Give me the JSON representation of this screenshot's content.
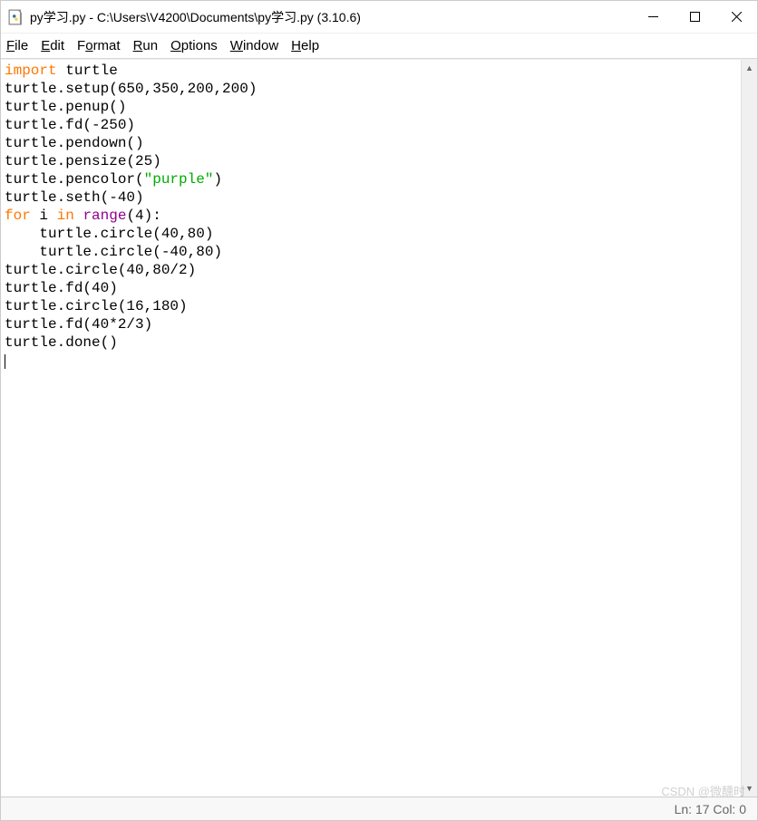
{
  "titlebar": {
    "title": "py学习.py - C:\\Users\\V4200\\Documents\\py学习.py (3.10.6)"
  },
  "menu": {
    "file": "File",
    "edit": "Edit",
    "format": "Format",
    "run": "Run",
    "options": "Options",
    "window": "Window",
    "help": "Help"
  },
  "code": {
    "l1_kw": "import",
    "l1_rest": " turtle",
    "l2": "turtle.setup(650,350,200,200)",
    "l3": "turtle.penup()",
    "l4": "turtle.fd(-250)",
    "l5": "turtle.pendown()",
    "l6": "turtle.pensize(25)",
    "l7a": "turtle.pencolor(",
    "l7s": "\"purple\"",
    "l7b": ")",
    "l8": "turtle.seth(-40)",
    "l9_for": "for",
    "l9_i": " i ",
    "l9_in": "in",
    "l9_sp": " ",
    "l9_range": "range",
    "l9_rest": "(4):",
    "l10": "    turtle.circle(40,80)",
    "l11": "    turtle.circle(-40,80)",
    "l12": "turtle.circle(40,80/2)",
    "l13": "turtle.fd(40)",
    "l14": "turtle.circle(16,180)",
    "l15": "turtle.fd(40*2/3)",
    "l16": "turtle.done()"
  },
  "status": {
    "text": "Ln: 17  Col: 0"
  },
  "watermark": "CSDN @微醺时"
}
